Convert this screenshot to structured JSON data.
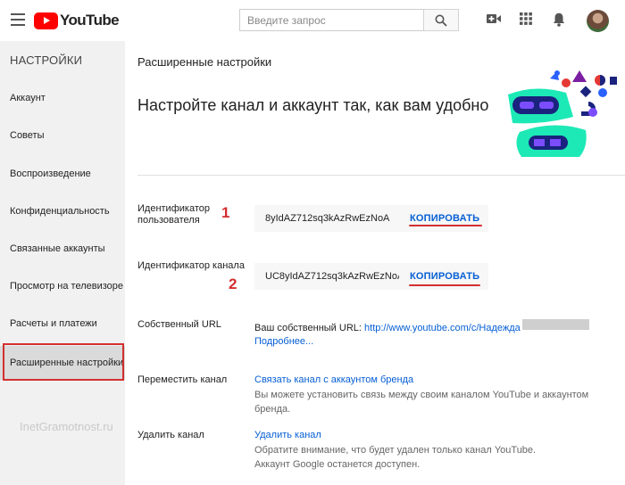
{
  "header": {
    "logo_text": "YouTube",
    "search_placeholder": "Введите запрос"
  },
  "sidebar": {
    "title": "НАСТРОЙКИ",
    "items": [
      {
        "label": "Аккаунт"
      },
      {
        "label": "Советы"
      },
      {
        "label": "Воспроизведение"
      },
      {
        "label": "Конфиденциальность"
      },
      {
        "label": "Связанные аккаунты"
      },
      {
        "label": "Просмотр на телевизоре"
      },
      {
        "label": "Расчеты и платежи"
      },
      {
        "label": "Расширенные настройки"
      }
    ],
    "active_index": 7
  },
  "watermark": "InetGramotnost.ru",
  "main": {
    "page_title": "Расширенные настройки",
    "hero_title": "Настройте канал и аккаунт так, как вам удобно",
    "user_id": {
      "label_line1": "Идентификатор",
      "label_line2": "пользователя",
      "value": "8yIdAZ712sq3kAzRwEzNoA",
      "copy_label": "КОПИРОВАТЬ",
      "marker": "1"
    },
    "channel_id": {
      "label": "Идентификатор канала",
      "value": "UC8yIdAZ712sq3kAzRwEzNoA",
      "copy_label": "КОПИРОВАТЬ",
      "marker": "2"
    },
    "custom_url": {
      "label": "Собственный URL",
      "prefix": "Ваш собственный URL:",
      "url": "http://www.youtube.com/c/Надежда",
      "more": "Подробнее..."
    },
    "move_channel": {
      "label": "Переместить канал",
      "link": "Связать канал с аккаунтом бренда",
      "desc": "Вы можете установить связь между своим каналом YouTube и аккаунтом бренда."
    },
    "delete_channel": {
      "label": "Удалить канал",
      "link": "Удалить канал",
      "desc_line1": "Обратите внимание, что будет удален только канал YouTube.",
      "desc_line2": "Аккаунт Google останется доступен."
    }
  },
  "colors": {
    "brand_red": "#ff0000",
    "link_blue": "#065fd4",
    "annotation_red": "#d32f2f",
    "sidebar_bg": "#f1f1f1"
  }
}
